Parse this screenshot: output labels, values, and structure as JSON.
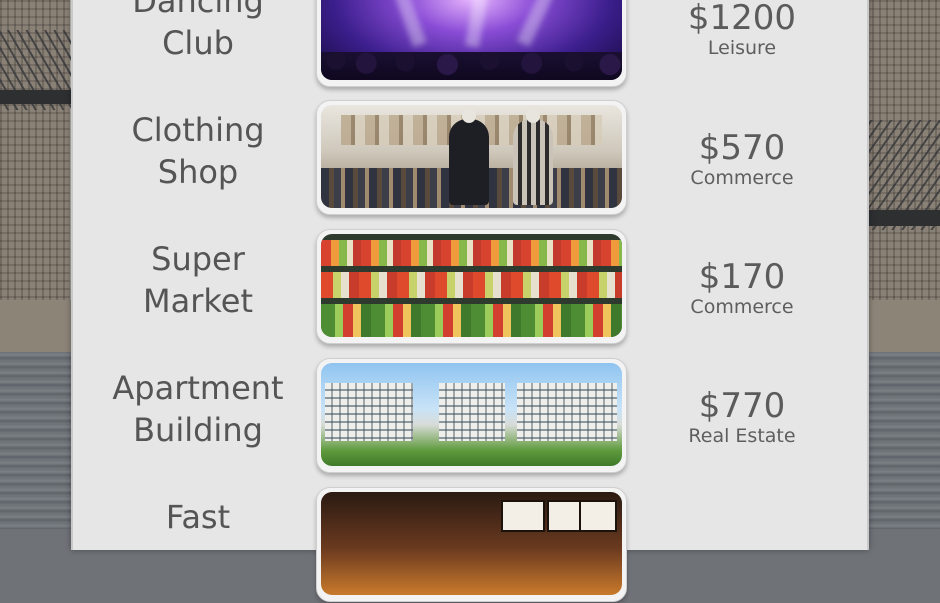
{
  "items": [
    {
      "name": "Dancing\nClub",
      "price": "$1200",
      "category": "Leisure",
      "image": "dancing-club-photo"
    },
    {
      "name": "Clothing\nShop",
      "price": "$570",
      "category": "Commerce",
      "image": "clothing-shop-photo"
    },
    {
      "name": "Super\nMarket",
      "price": "$170",
      "category": "Commerce",
      "image": "supermarket-photo"
    },
    {
      "name": "Apartment\nBuilding",
      "price": "$770",
      "category": "Real Estate",
      "image": "apartment-building-photo"
    },
    {
      "name": "Fast",
      "price": "",
      "category": "",
      "image": "fast-food-photo"
    }
  ]
}
